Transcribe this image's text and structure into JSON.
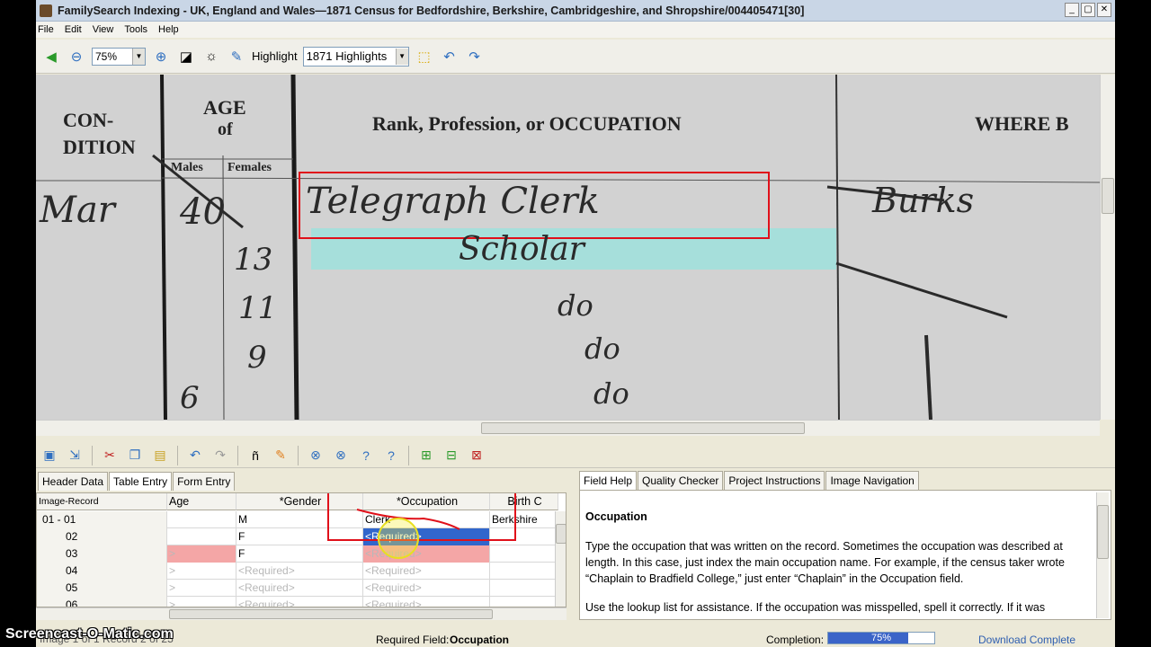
{
  "window": {
    "title": "FamilySearch Indexing - UK, England and Wales—1871 Census for Bedfordshire, Berkshire, Cambridgeshire, and Shropshire/004405471[30]",
    "controls": [
      "_",
      "▢",
      "✕"
    ]
  },
  "menu": [
    "File",
    "Edit",
    "View",
    "Tools",
    "Help"
  ],
  "toolbar": {
    "zoom_value": "75%",
    "highlight_label": "Highlight",
    "highlight_value": "1871 Highlights"
  },
  "image": {
    "condition_header": "CON-\nDITION",
    "age_header": "AGE",
    "age_of": "of",
    "males": "Males",
    "females": "Females",
    "occupation_header": "Rank, Profession, or OCCUPATION",
    "where_header": "WHERE B",
    "handwriting": [
      "Telegraph Clerk",
      "Scholar",
      "do",
      "do",
      "do",
      "Mar",
      "40",
      "13",
      "11",
      "9",
      "6",
      "Burks"
    ]
  },
  "tabs_left": [
    "Header Data",
    "Table Entry",
    "Form Entry"
  ],
  "tabs_right": [
    "Field Help",
    "Quality Checker",
    "Project Instructions",
    "Image Navigation"
  ],
  "grid": {
    "headers": [
      "Image-Record",
      "Age",
      "*Gender",
      "*Occupation",
      "Birth C"
    ],
    "rows": [
      {
        "record": "01 - 01",
        "age": "",
        "gender": "M",
        "occupation": "Clerk",
        "birth": "Berkshire"
      },
      {
        "record": "02",
        "age": "",
        "gender": "F",
        "occupation": "<Required>",
        "birth": ""
      },
      {
        "record": "03",
        "age": ">",
        "gender": "F",
        "occupation": "<Required>",
        "birth": ""
      },
      {
        "record": "04",
        "age": ">",
        "gender": "<Required>",
        "occupation": "<Required>",
        "birth": ""
      },
      {
        "record": "05",
        "age": ">",
        "gender": "<Required>",
        "occupation": "<Required>",
        "birth": ""
      },
      {
        "record": "06",
        "age": ">",
        "gender": "<Required>",
        "occupation": "<Required>",
        "birth": ""
      }
    ]
  },
  "help": {
    "title": "Occupation",
    "p1": "Type the occupation that was written on the record. Sometimes the occupation was described at length. In this case, just index the main occupation name. For example, if the census taker wrote “Chaplain to Bradfield College,” just enter “Chaplain” in the Occupation field.",
    "p2": "Use the lookup list for assistance. If the occupation was misspelled, spell it correctly. If it was"
  },
  "status": {
    "left": "Image 1 of 1  Record 2 of 25",
    "required_label": "Required Field:",
    "required_value": "Occupation",
    "completion_label": "Completion:",
    "completion_value": "75%",
    "completion_fraction": 0.75,
    "download": "Download Complete"
  },
  "watermark": "Screencast-O-Matic.com",
  "colors": {
    "selection": "#3166cc",
    "error": "#f4a6a6",
    "annotation_red": "#e0101a",
    "highlight_cyan": "#9fe0dc",
    "cursor_yellow": "#f5ef3a"
  }
}
